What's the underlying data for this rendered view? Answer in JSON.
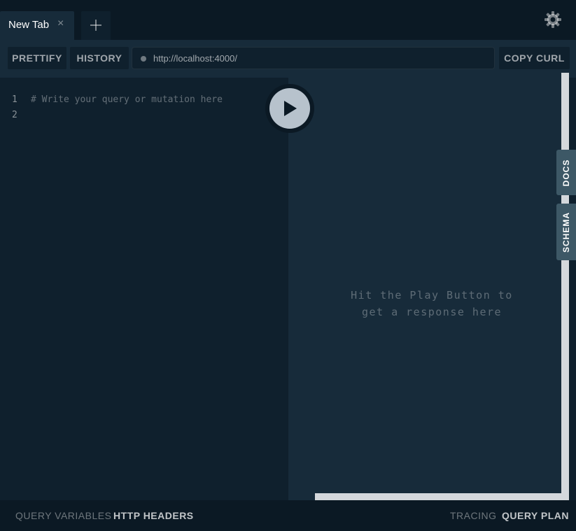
{
  "tabs": [
    {
      "label": "New Tab",
      "close": "×"
    }
  ],
  "toolbar": {
    "prettify": "PRETTIFY",
    "history": "HISTORY",
    "url": "http://localhost:4000/",
    "copy_curl": "COPY CURL"
  },
  "editor": {
    "line_numbers": [
      "1",
      "2"
    ],
    "lines": [
      "# Write your query or mutation here",
      ""
    ]
  },
  "result": {
    "placeholder_line1": "Hit the Play Button to",
    "placeholder_line2": "get a response here"
  },
  "side_tabs": {
    "docs": "DOCS",
    "schema": "SCHEMA"
  },
  "bottom": {
    "query_variables": "QUERY VARIABLES",
    "http_headers": "HTTP HEADERS",
    "tracing": "TRACING",
    "query_plan": "QUERY PLAN"
  },
  "icons": {
    "settings": "gear-icon",
    "add_tab": "plus-icon",
    "play": "play-icon",
    "status": "status-dot-icon"
  },
  "colors": {
    "background": "#0f202d",
    "tabbar": "#0b1924",
    "toolbar": "#172b3a",
    "side_tab": "#3d5866",
    "play_button": "#b7c2cc"
  }
}
